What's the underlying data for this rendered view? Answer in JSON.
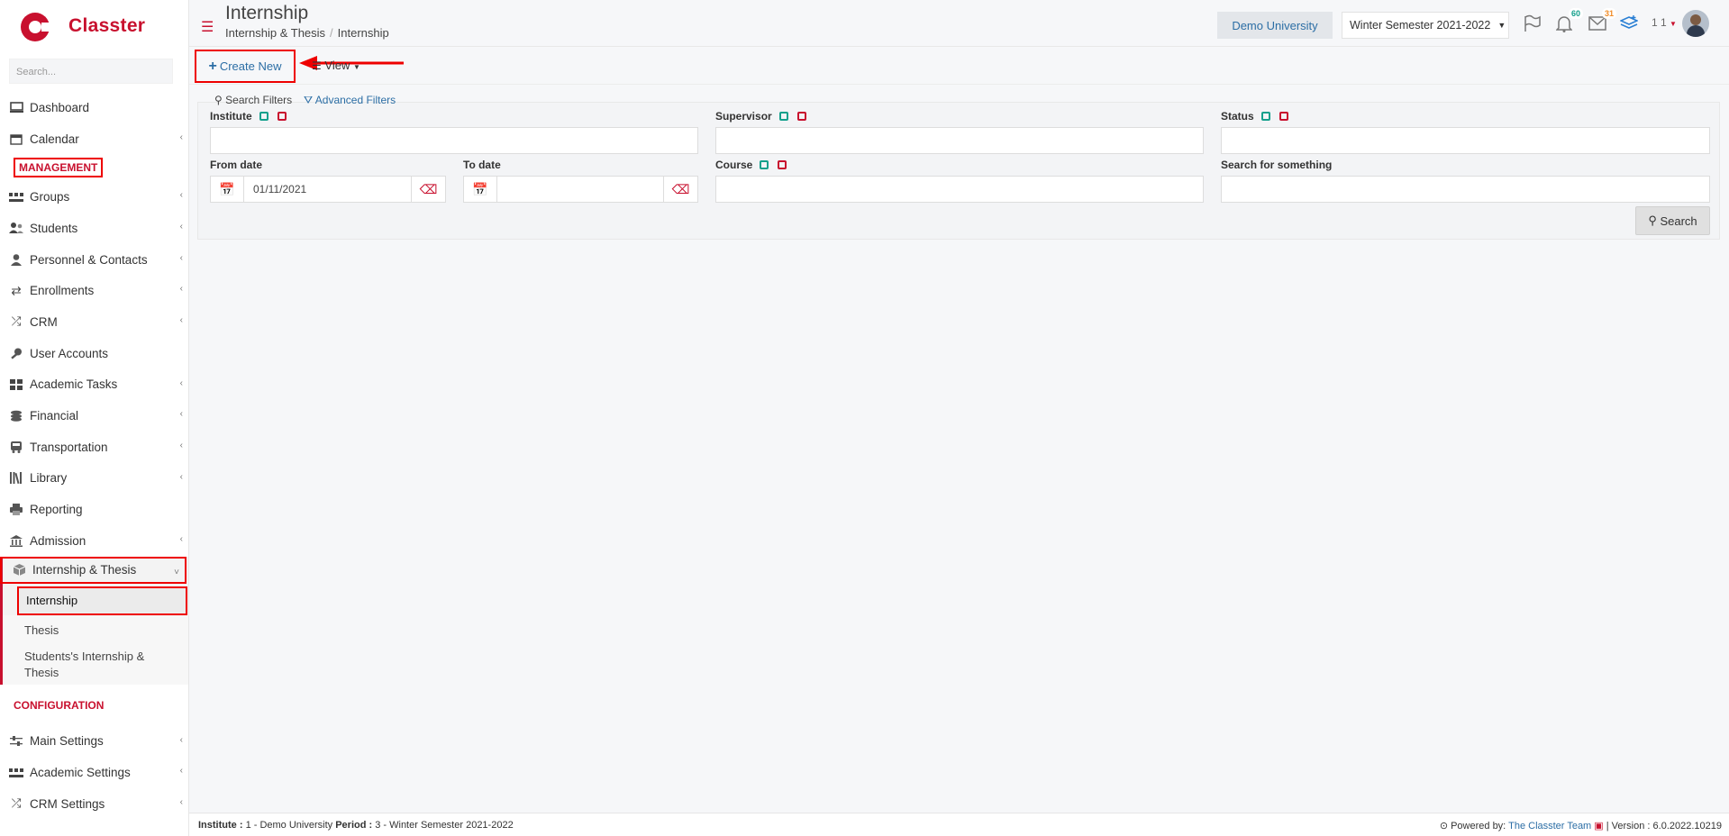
{
  "sidebar": {
    "logo_text": "Classter",
    "search_placeholder": "Search...",
    "items_top": [
      {
        "label": "Dashboard",
        "icon": "monitor-icon"
      },
      {
        "label": "Calendar",
        "icon": "calendar-icon"
      }
    ],
    "management_label": "MANAGEMENT",
    "management_items": [
      {
        "label": "Groups",
        "icon": "groups-icon"
      },
      {
        "label": "Students",
        "icon": "students-icon"
      },
      {
        "label": "Personnel & Contacts",
        "icon": "person-icon"
      },
      {
        "label": "Enrollments",
        "icon": "exchange-icon"
      },
      {
        "label": "CRM",
        "icon": "shuffle-icon"
      },
      {
        "label": "User Accounts",
        "icon": "key-icon"
      },
      {
        "label": "Academic Tasks",
        "icon": "grid-icon"
      },
      {
        "label": "Financial",
        "icon": "coins-icon"
      },
      {
        "label": "Transportation",
        "icon": "bus-icon"
      },
      {
        "label": "Library",
        "icon": "books-icon"
      },
      {
        "label": "Reporting",
        "icon": "printer-icon"
      },
      {
        "label": "Admission",
        "icon": "institution-icon"
      }
    ],
    "open_group": {
      "label": "Internship & Thesis",
      "icon": "box-icon",
      "children": [
        "Internship",
        "Thesis",
        "Students's Internship & Thesis"
      ]
    },
    "configuration_label": "CONFIGURATION",
    "config_items": [
      {
        "label": "Main Settings",
        "icon": "sliders-icon"
      },
      {
        "label": "Academic Settings",
        "icon": "academic-icon"
      },
      {
        "label": "CRM Settings",
        "icon": "shuffle-icon"
      }
    ]
  },
  "header": {
    "title": "Internship",
    "breadcrumb": [
      "Internship & Thesis",
      "Internship"
    ],
    "university": "Demo University",
    "semester": "Winter Semester 2021-2022",
    "notifications_count": "60",
    "messages_count": "31",
    "user_text": "1 1"
  },
  "toolbar": {
    "create_label": "Create New",
    "view_label": "View"
  },
  "filters": {
    "search_filters_label": "Search Filters",
    "advanced_filters_label": "Advanced Filters",
    "institute_label": "Institute",
    "supervisor_label": "Supervisor",
    "status_label": "Status",
    "from_date_label": "From date",
    "from_date_value": "01/11/2021",
    "to_date_label": "To date",
    "to_date_value": "",
    "course_label": "Course",
    "search_something_label": "Search for something",
    "search_button": "Search"
  },
  "footer": {
    "institute_label": "Institute :",
    "institute_value": "1 - Demo University",
    "period_label": "Period :",
    "period_value": "3 - Winter Semester 2021-2022",
    "powered_by": "Powered by:",
    "team": "The Classter Team",
    "version": "| Version : 6.0.2022.10219"
  }
}
